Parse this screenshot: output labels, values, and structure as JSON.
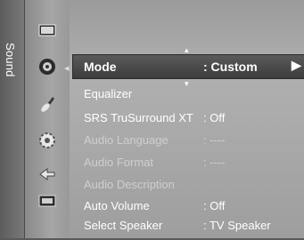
{
  "menu": {
    "section_title": "Sound",
    "selected_item": {
      "label": "Mode",
      "value": ": Custom"
    },
    "items": [
      {
        "label": "Equalizer",
        "value": "",
        "enabled": true
      },
      {
        "label": "SRS TruSurround XT",
        "value": ": Off",
        "enabled": true
      },
      {
        "label": "Audio Language",
        "value": ": ----",
        "enabled": false
      },
      {
        "label": "Audio Format",
        "value": ": ----",
        "enabled": false
      },
      {
        "label": "Audio Description",
        "value": "",
        "enabled": false
      },
      {
        "label": "Auto Volume",
        "value": ": Off",
        "enabled": true
      },
      {
        "label": "Select Speaker",
        "value": ": TV Speaker",
        "enabled": true
      }
    ]
  },
  "sidebar_icons": [
    "picture-icon",
    "sound-icon",
    "channel-icon",
    "setup-icon",
    "input-icon",
    "application-icon"
  ],
  "colors": {
    "selected_bg": "#4a4a4a",
    "panel_bg": "#a8a8a8",
    "text": "#ffffff",
    "disabled_text": "#cfcfcf"
  }
}
